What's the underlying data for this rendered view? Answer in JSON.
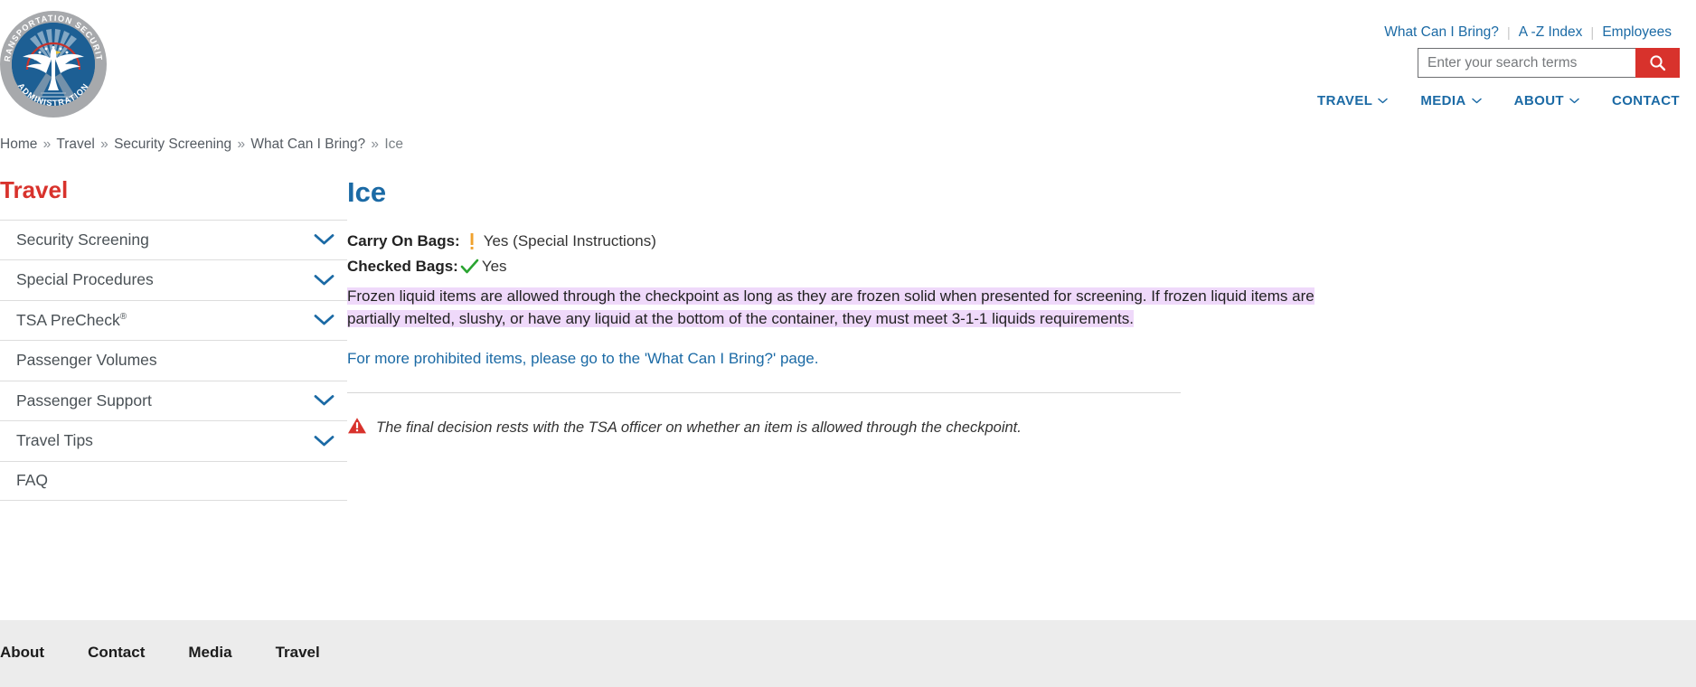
{
  "header": {
    "logo": {
      "outer_text_top": "TRANSPORTATION SECURITY",
      "outer_text_bottom": "ADMINISTRATION",
      "alt": "Transportation Security Administration seal"
    },
    "utility_nav": [
      {
        "label": "What Can I Bring?"
      },
      {
        "label": "A -Z Index"
      },
      {
        "label": "Employees"
      }
    ],
    "utility_separator": "|",
    "search": {
      "placeholder": "Enter your search terms",
      "value": "",
      "button_label": "Search",
      "button_color": "#d8322c"
    },
    "main_nav": [
      {
        "label": "TRAVEL",
        "has_dropdown": true
      },
      {
        "label": "MEDIA",
        "has_dropdown": true
      },
      {
        "label": "ABOUT",
        "has_dropdown": true
      },
      {
        "label": "CONTACT",
        "has_dropdown": false
      }
    ]
  },
  "breadcrumb": {
    "separator": "»",
    "items": [
      {
        "label": "Home",
        "current": false
      },
      {
        "label": "Travel",
        "current": false
      },
      {
        "label": "Security Screening",
        "current": false
      },
      {
        "label": "What Can I Bring?",
        "current": false
      },
      {
        "label": "Ice",
        "current": true
      }
    ]
  },
  "sidebar": {
    "title": "Travel",
    "title_color": "#d8322c",
    "items": [
      {
        "label": "Security Screening",
        "has_chevron": true
      },
      {
        "label": "Special Procedures",
        "has_chevron": true
      },
      {
        "label": "TSA PreCheck",
        "superscript": "®",
        "has_chevron": true
      },
      {
        "label": "Passenger Volumes",
        "has_chevron": false
      },
      {
        "label": "Passenger Support",
        "has_chevron": true
      },
      {
        "label": "Travel Tips",
        "has_chevron": true
      },
      {
        "label": "FAQ",
        "has_chevron": false
      }
    ]
  },
  "main": {
    "title": "Ice",
    "title_color": "#1b6aa5",
    "carry_on": {
      "label": "Carry On Bags:",
      "icon": "exclamation-icon",
      "icon_color": "#f0a22e",
      "value": "Yes (Special Instructions)"
    },
    "checked": {
      "label": "Checked Bags:",
      "icon": "check-icon",
      "icon_color": "#2aa431",
      "value": "Yes"
    },
    "description": "Frozen liquid items are allowed through the checkpoint as long as they are frozen solid when presented for screening. If frozen liquid items are partially melted, slushy, or have any liquid at the bottom of the container, they must meet 3-1-1 liquids requirements.",
    "description_highlight_color": "#efd9fa",
    "more_link": "For more prohibited items, please go to the 'What Can I Bring?' page.",
    "disclaimer": {
      "icon": "warning-triangle-icon",
      "icon_color": "#d8322c",
      "text": "The final decision rests with the TSA officer on whether an item is allowed through the checkpoint."
    }
  },
  "footer": {
    "links": [
      {
        "label": "About"
      },
      {
        "label": "Contact"
      },
      {
        "label": "Media"
      },
      {
        "label": "Travel"
      }
    ]
  }
}
